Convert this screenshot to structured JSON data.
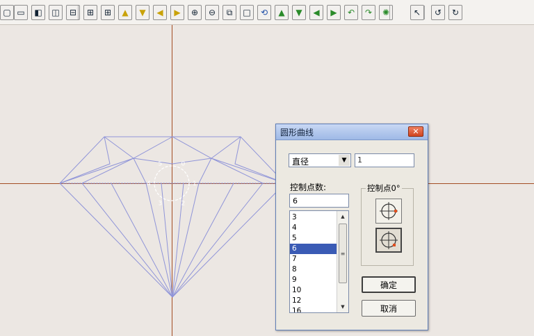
{
  "toolbar": {
    "buttons": [
      {
        "name": "view-single-icon",
        "glyph": "▢"
      },
      {
        "name": "view-top-icon",
        "glyph": "▭"
      },
      {
        "name": "view-left-icon",
        "glyph": "◧"
      },
      {
        "name": "view-split-vertical-icon",
        "glyph": "◫"
      },
      {
        "name": "view-split-horizontal-icon",
        "glyph": "⊟"
      },
      {
        "name": "view-quad-icon",
        "glyph": "⊞"
      },
      {
        "name": "view-quad-alt-icon",
        "glyph": "⊞"
      },
      {
        "name": "move-up-icon",
        "glyph": "▲"
      },
      {
        "name": "move-down-icon",
        "glyph": "▼"
      },
      {
        "name": "move-left-icon",
        "glyph": "◀"
      },
      {
        "name": "move-right-icon",
        "glyph": "▶"
      },
      {
        "name": "zoom-in-icon",
        "glyph": "⊕"
      },
      {
        "name": "zoom-out-icon",
        "glyph": "⊖"
      },
      {
        "name": "zoom-window-icon",
        "glyph": "⧉"
      },
      {
        "name": "zoom-fit-icon",
        "glyph": "□"
      },
      {
        "name": "rotate-view-icon",
        "glyph": "⟲"
      },
      {
        "name": "rotate-up-icon",
        "glyph": "▲"
      },
      {
        "name": "rotate-down-icon",
        "glyph": "▼"
      },
      {
        "name": "rotate-left-icon",
        "glyph": "◀"
      },
      {
        "name": "rotate-right-icon",
        "glyph": "▶"
      },
      {
        "name": "turn-left-icon",
        "glyph": "↶"
      },
      {
        "name": "turn-right-icon",
        "glyph": "↷"
      },
      {
        "name": "orbit-icon",
        "glyph": "✺"
      },
      {
        "name": "select-cursor-icon",
        "glyph": "↖"
      },
      {
        "name": "undo-icon",
        "glyph": "↺"
      },
      {
        "name": "redo-icon",
        "glyph": "↻"
      }
    ]
  },
  "dialog": {
    "title": "圆形曲线",
    "close_glyph": "✕",
    "mode_select": {
      "value": "直径",
      "arrow_glyph": "▼"
    },
    "size_value": "1",
    "count_label": "控制点数:",
    "count_value": "6",
    "count_options": [
      "3",
      "4",
      "5",
      "6",
      "7",
      "8",
      "9",
      "10",
      "12",
      "16"
    ],
    "selected_index": 3,
    "scroll_up_glyph": "▲",
    "scroll_down_glyph": "▼",
    "scroll_thumb_glyph": "≡",
    "group_title": "控制点0°",
    "ok_label": "确定",
    "cancel_label": "取消"
  },
  "canvas": {
    "axis_color": "#a34b22",
    "wire_color": "#8f94d8",
    "control_point_labels": [
      "0",
      "1",
      "2",
      "3",
      "4",
      "5"
    ]
  }
}
